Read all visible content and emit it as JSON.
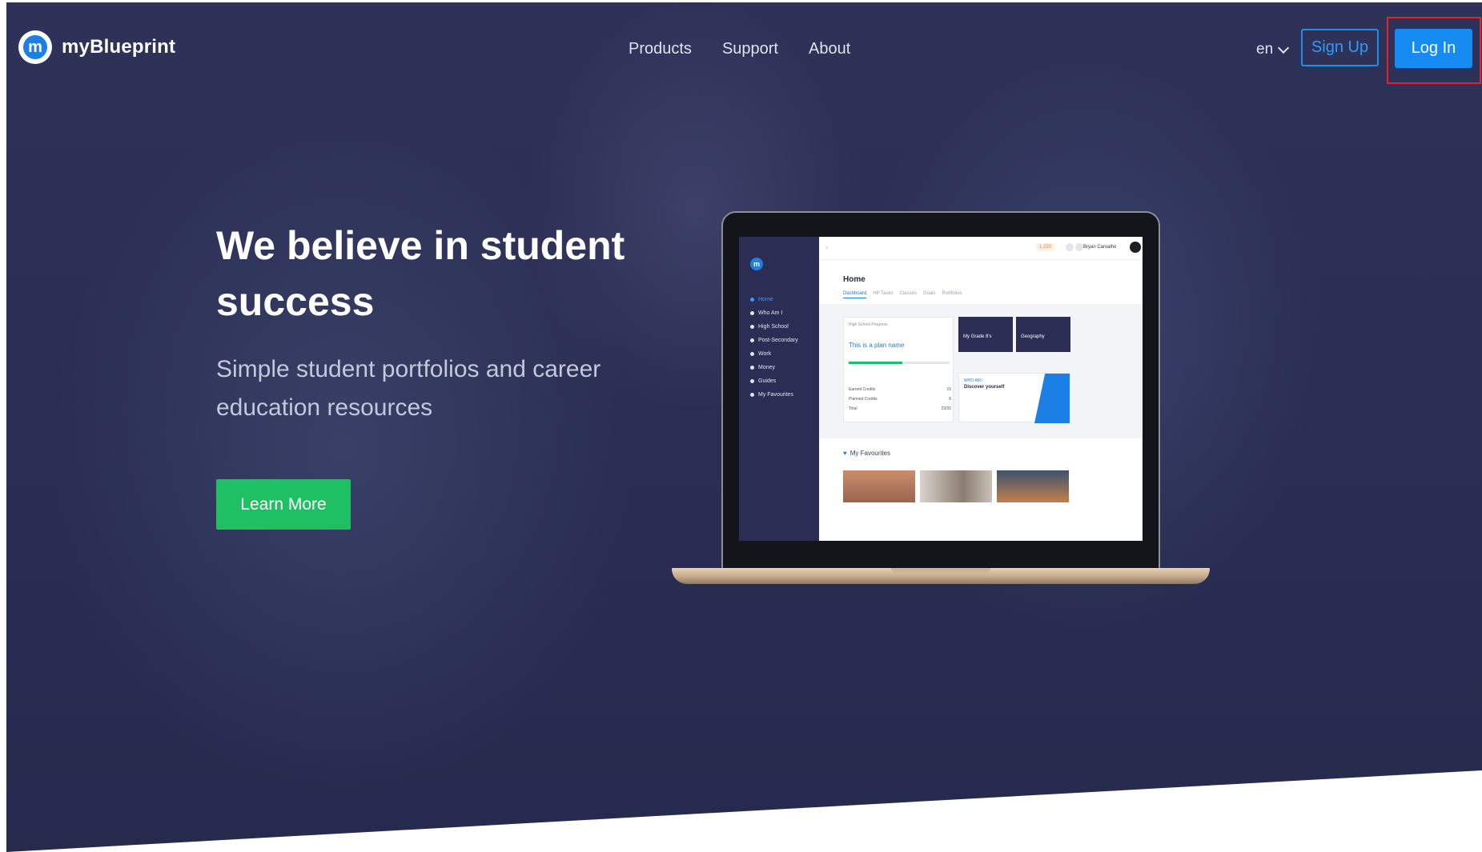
{
  "brand": {
    "name": "myBlueprint",
    "logo_glyph": "m"
  },
  "nav": {
    "items": [
      "Products",
      "Support",
      "About"
    ]
  },
  "lang": {
    "value": "en"
  },
  "auth": {
    "signup_label": "Sign Up",
    "login_label": "Log In"
  },
  "hero": {
    "headline": "We believe in student success",
    "subheadline": "Simple student portfolios and career education resources",
    "cta_label": "Learn More"
  },
  "mockup": {
    "sidebar_logo": "m",
    "sidebar_items": [
      "Home",
      "Who Am I",
      "High School",
      "Post-Secondary",
      "Work",
      "Money",
      "Guides",
      "My Favourites"
    ],
    "coins": "1,250",
    "username": "Bryan Carvalho",
    "home_title": "Home",
    "tabs": [
      "Dashboard",
      "HP Tasks",
      "Classes",
      "Goals",
      "Portfolios"
    ],
    "plan_label": "High School Progress",
    "plan_name": "This is a plan name",
    "plan_progress": 0.53,
    "credits": [
      {
        "label": "Earned Credits",
        "value": "15"
      },
      {
        "label": "Planned Credits",
        "value": "8"
      },
      {
        "label": "Total",
        "value": "23/30"
      }
    ],
    "card_one": "My Grade 8's",
    "card_two": "Geography",
    "discover_tag": "WHO AM I",
    "discover_title": "Discover yourself",
    "favourites_title": "My Favourites"
  },
  "colors": {
    "accent_blue": "#168cf2",
    "cta_green": "#1fbf63",
    "hero_navy": "#2a2e53",
    "highlight_red": "#e2232b"
  }
}
